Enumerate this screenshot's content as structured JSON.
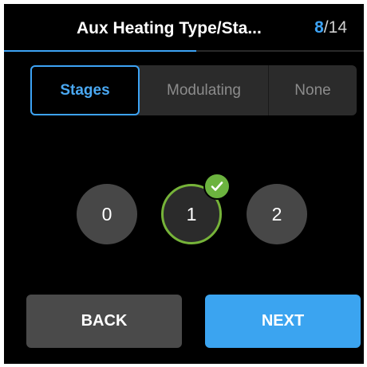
{
  "header": {
    "title": "Aux Heating Type/Sta...",
    "step_current": "8",
    "step_separator": "/",
    "step_total": "14",
    "progress_fraction": 0.535
  },
  "segmented": {
    "options": [
      {
        "label": "Stages",
        "selected": true
      },
      {
        "label": "Modulating",
        "selected": false
      },
      {
        "label": "None",
        "selected": false
      }
    ]
  },
  "stages": {
    "options": [
      "0",
      "1",
      "2"
    ],
    "selected": "1",
    "selected_icon": "checkmark-icon"
  },
  "buttons": {
    "back_label": "BACK",
    "next_label": "NEXT"
  },
  "colors": {
    "accent": "#3da3f5",
    "success": "#6cb33f",
    "background": "#000000"
  }
}
